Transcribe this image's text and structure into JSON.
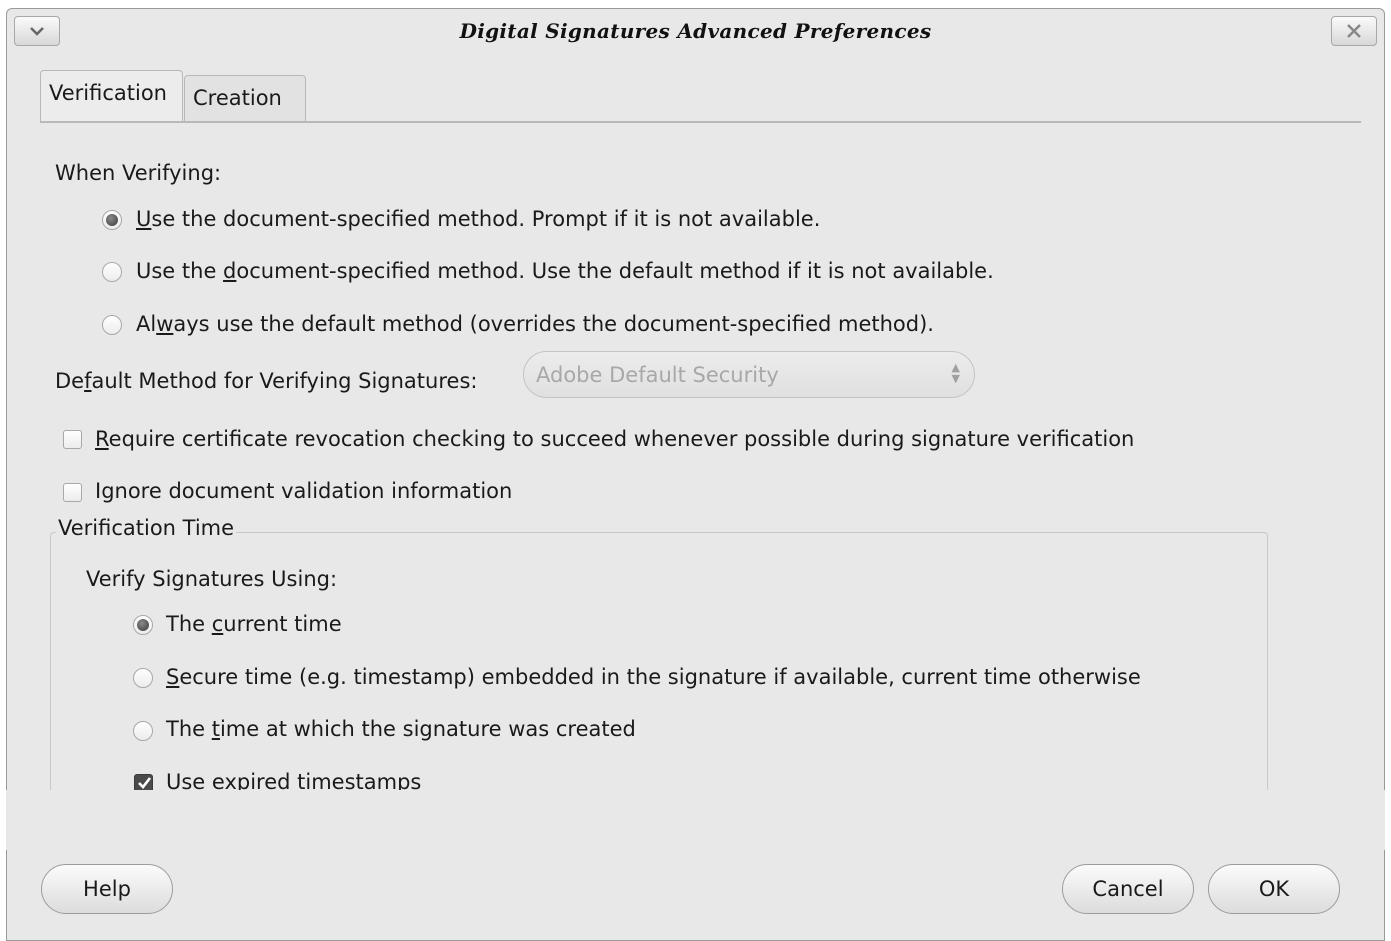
{
  "window": {
    "title": "Digital Signatures Advanced Preferences"
  },
  "titlebar": {
    "menu_icon": "chevron-down-icon",
    "close_icon": "close-icon"
  },
  "tabs": [
    {
      "label": "Verification",
      "active": true
    },
    {
      "label": "Creation",
      "active": false
    }
  ],
  "verification": {
    "when_verifying_label": "When Verifying:",
    "options": [
      {
        "pre": "",
        "mn": "U",
        "post": "se the document-specified method. Prompt if it is not available.",
        "selected": true
      },
      {
        "pre": "Use the ",
        "mn": "d",
        "post": "ocument-specified method. Use the default method if it is not available.",
        "selected": false
      },
      {
        "pre": "Al",
        "mn": "w",
        "post": "ays use the default method (overrides the document-specified method).",
        "selected": false
      }
    ],
    "default_method": {
      "label_pre": "De",
      "label_mn": "f",
      "label_post": "ault Method for Verifying Signatures:",
      "value": "Adobe Default Security"
    },
    "require_revocation": {
      "pre": "",
      "mn": "R",
      "post": "equire certificate revocation checking to succeed whenever possible during signature verification",
      "checked": false
    },
    "ignore_validation": {
      "label": "Ignore document validation information",
      "checked": false
    },
    "time_group": {
      "title": "Verification Time",
      "verify_using_label": "Verify Signatures Using:",
      "options": [
        {
          "pre": "The ",
          "mn": "c",
          "post": "urrent time",
          "selected": true
        },
        {
          "pre": "",
          "mn": "S",
          "post": "ecure time (e.g. timestamp) embedded in the signature if available, current time otherwise",
          "selected": false
        },
        {
          "pre": "The ",
          "mn": "t",
          "post": "ime at which the signature was created",
          "selected": false
        }
      ],
      "use_expired": {
        "label": "Use expired timestamps",
        "checked": true
      }
    }
  },
  "footer": {
    "help": "Help",
    "cancel": "Cancel",
    "ok": "OK"
  }
}
